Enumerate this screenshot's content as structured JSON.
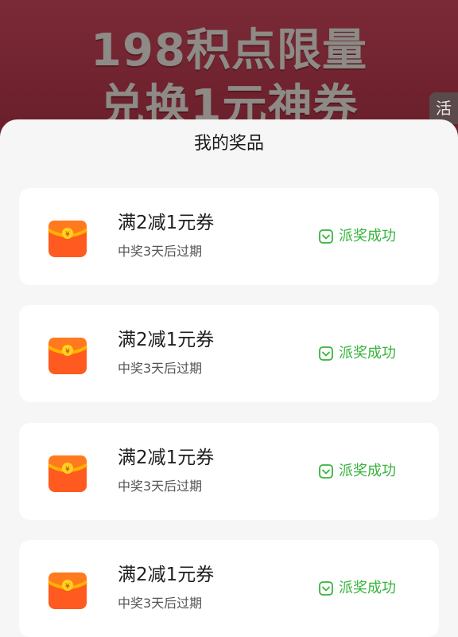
{
  "banner": {
    "line1": "198积点限量",
    "line2": "兑换1元神券",
    "side_tab": "活"
  },
  "sheet": {
    "title": "我的奖品"
  },
  "prizes": [
    {
      "title": "满2减1元券",
      "subtitle": "中奖3天后过期",
      "status": "派奖成功",
      "icon": "red-envelope-icon"
    },
    {
      "title": "满2减1元券",
      "subtitle": "中奖3天后过期",
      "status": "派奖成功",
      "icon": "red-envelope-icon"
    },
    {
      "title": "满2减1元券",
      "subtitle": "中奖3天后过期",
      "status": "派奖成功",
      "icon": "red-envelope-icon"
    },
    {
      "title": "满2减1元券",
      "subtitle": "中奖3天后过期",
      "status": "派奖成功",
      "icon": "red-envelope-icon"
    }
  ],
  "colors": {
    "status_green": "#36b43c",
    "envelope_orange": "#ff5a1f",
    "envelope_flap": "#ffb400"
  },
  "currency_symbol": "¥"
}
